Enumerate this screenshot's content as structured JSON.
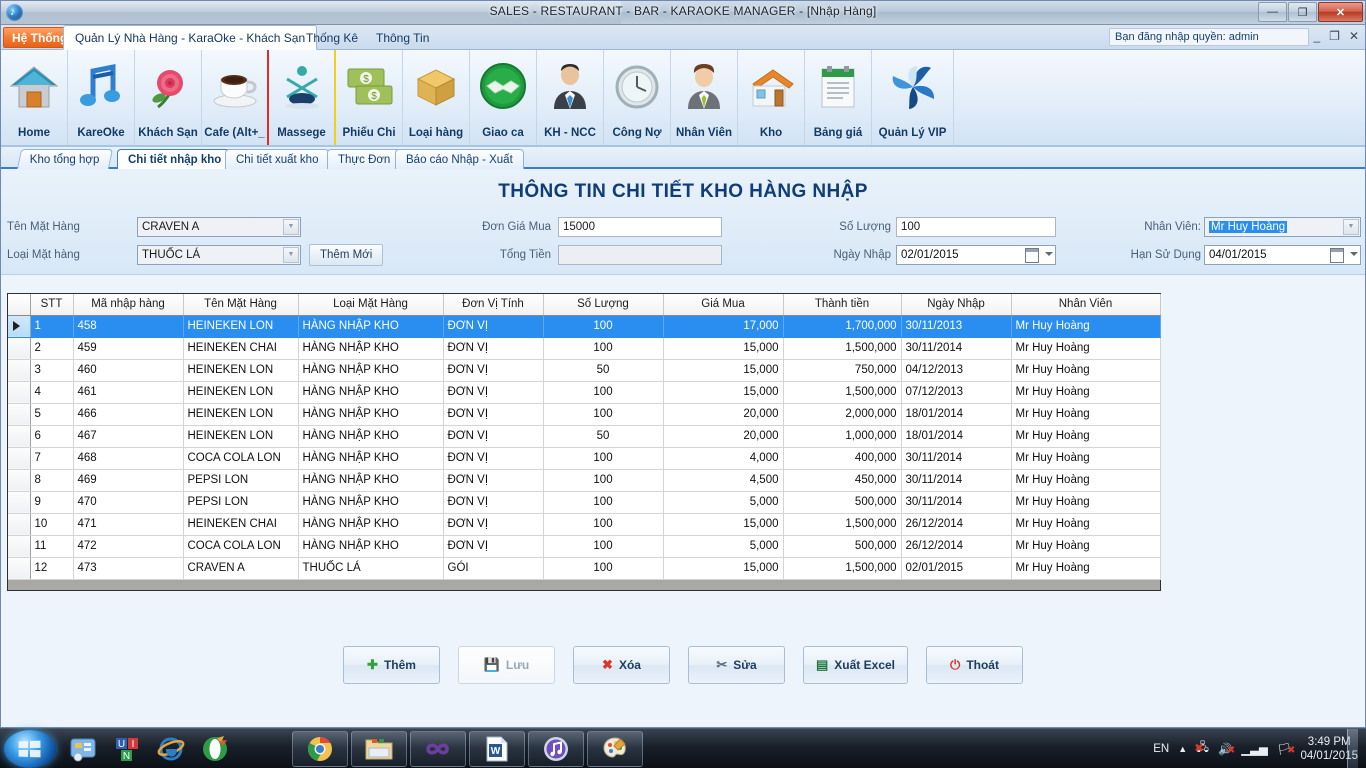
{
  "window": {
    "title": "SALES - RESTAURANT - BAR - KARAOKE MANAGER - [Nhập Hàng]",
    "icon": "music-note-icon",
    "minimize_label": "—",
    "maximize_label": "❐",
    "close_label": "✕"
  },
  "menu": {
    "system_button": "Hệ Thống",
    "tabs": [
      {
        "label": "Quản Lý Nhà Hàng - KaraOke - Khách Sạn",
        "active": true
      },
      {
        "label": "Thống Kê",
        "active": false
      },
      {
        "label": "Thông Tin",
        "active": false
      }
    ],
    "user_info": "Bạn đăng nhập quyền: admin",
    "mdi_minimize": "_",
    "mdi_restore": "❐",
    "mdi_close": "✕"
  },
  "ribbon": {
    "items": [
      {
        "label": "Home",
        "icon": "home-icon"
      },
      {
        "label": "KareOke",
        "icon": "music-notes-icon"
      },
      {
        "label": "Khách Sạn",
        "icon": "rose-icon"
      },
      {
        "label": "Cafe (Alt+_",
        "icon": "coffee-cup-icon"
      },
      {
        "label": "Massege",
        "icon": "massage-person-icon"
      },
      {
        "label": "Phiếu Chi",
        "icon": "money-bills-icon"
      },
      {
        "label": "Loại hàng",
        "icon": "wooden-box-icon"
      },
      {
        "label": "Giao ca",
        "icon": "handshake-icon"
      },
      {
        "label": "KH - NCC",
        "icon": "businessman-icon"
      },
      {
        "label": "Công Nợ",
        "icon": "clock-icon"
      },
      {
        "label": "Nhân Viên",
        "icon": "employee-icon"
      },
      {
        "label": "Kho",
        "icon": "warehouse-icon"
      },
      {
        "label": "Bảng giá",
        "icon": "pricelist-clipboard-icon"
      },
      {
        "label": "Quản Lý VIP",
        "icon": "vip-fan-icon"
      }
    ]
  },
  "page_tabs": [
    {
      "label": "Kho tổng hợp",
      "active": false
    },
    {
      "label": "Chi tiết nhập kho",
      "active": true
    },
    {
      "label": "Chi tiết xuất kho",
      "active": false
    },
    {
      "label": "Thực Đơn",
      "active": false
    },
    {
      "label": "Báo cáo Nhập - Xuất",
      "active": false
    }
  ],
  "form": {
    "title": "THÔNG TIN CHI TIẾT KHO HÀNG NHẬP",
    "ten_mat_hang_label": "Tên Mặt Hàng",
    "ten_mat_hang_value": "CRAVEN A",
    "loai_mat_hang_label": "Loại Mặt hàng",
    "loai_mat_hang_value": "THUỐC LÁ",
    "them_moi_label": "Thêm Mới",
    "don_gia_mua_label": "Đơn Giá Mua",
    "don_gia_mua_value": "15000",
    "tong_tien_label": "Tổng Tiền",
    "tong_tien_value": "",
    "so_luong_label": "Số Lượng",
    "so_luong_value": "100",
    "ngay_nhap_label": "Ngày Nhập",
    "ngay_nhap_value": "02/01/2015",
    "nhan_vien_label": "Nhân Viên:",
    "nhan_vien_value": "Mr Huy Hoàng",
    "han_su_dung_label": "Hạn Sử Dụng",
    "han_su_dung_value": "04/01/2015"
  },
  "grid": {
    "columns": [
      "STT",
      "Mã nhập hàng",
      "Tên Mặt Hàng",
      "Loại Mặt Hàng",
      "Đơn Vị Tính",
      "Số Lượng",
      "Giá Mua",
      "Thành tiền",
      "Ngày Nhập",
      "Nhân Viên"
    ],
    "rows": [
      {
        "stt": "1",
        "ma": "458",
        "ten": "HEINEKEN LON",
        "loai": "HÀNG NHẬP KHO",
        "dvt": "ĐƠN VỊ",
        "sl": "100",
        "gia": "17,000",
        "tt": "1,700,000",
        "ngay": "30/11/2013",
        "nv": "Mr Huy Hoàng",
        "selected": true
      },
      {
        "stt": "2",
        "ma": "459",
        "ten": "HEINEKEN CHAI",
        "loai": "HÀNG NHẬP KHO",
        "dvt": "ĐƠN VỊ",
        "sl": "100",
        "gia": "15,000",
        "tt": "1,500,000",
        "ngay": "30/11/2014",
        "nv": "Mr Huy Hoàng",
        "selected": false
      },
      {
        "stt": "3",
        "ma": "460",
        "ten": "HEINEKEN LON",
        "loai": "HÀNG NHẬP KHO",
        "dvt": "ĐƠN VỊ",
        "sl": "50",
        "gia": "15,000",
        "tt": "750,000",
        "ngay": "04/12/2013",
        "nv": "Mr Huy Hoàng",
        "selected": false
      },
      {
        "stt": "4",
        "ma": "461",
        "ten": "HEINEKEN LON",
        "loai": "HÀNG NHẬP KHO",
        "dvt": "ĐƠN VỊ",
        "sl": "100",
        "gia": "15,000",
        "tt": "1,500,000",
        "ngay": "07/12/2013",
        "nv": "Mr Huy Hoàng",
        "selected": false
      },
      {
        "stt": "5",
        "ma": "466",
        "ten": "HEINEKEN LON",
        "loai": "HÀNG NHẬP KHO",
        "dvt": "ĐƠN VỊ",
        "sl": "100",
        "gia": "20,000",
        "tt": "2,000,000",
        "ngay": "18/01/2014",
        "nv": "Mr Huy Hoàng",
        "selected": false
      },
      {
        "stt": "6",
        "ma": "467",
        "ten": "HEINEKEN LON",
        "loai": "HÀNG NHẬP KHO",
        "dvt": "ĐƠN VỊ",
        "sl": "50",
        "gia": "20,000",
        "tt": "1,000,000",
        "ngay": "18/01/2014",
        "nv": "Mr Huy Hoàng",
        "selected": false
      },
      {
        "stt": "7",
        "ma": "468",
        "ten": "COCA COLA LON",
        "loai": "HÀNG NHẬP KHO",
        "dvt": "ĐƠN VỊ",
        "sl": "100",
        "gia": "4,000",
        "tt": "400,000",
        "ngay": "30/11/2014",
        "nv": "Mr Huy Hoàng",
        "selected": false
      },
      {
        "stt": "8",
        "ma": "469",
        "ten": "PEPSI LON",
        "loai": "HÀNG NHẬP KHO",
        "dvt": "ĐƠN VỊ",
        "sl": "100",
        "gia": "4,500",
        "tt": "450,000",
        "ngay": "30/11/2014",
        "nv": "Mr Huy Hoàng",
        "selected": false
      },
      {
        "stt": "9",
        "ma": "470",
        "ten": "PEPSI LON",
        "loai": "HÀNG NHẬP KHO",
        "dvt": "ĐƠN VỊ",
        "sl": "100",
        "gia": "5,000",
        "tt": "500,000",
        "ngay": "30/11/2014",
        "nv": "Mr Huy Hoàng",
        "selected": false
      },
      {
        "stt": "10",
        "ma": "471",
        "ten": "HEINEKEN CHAI",
        "loai": "HÀNG NHẬP KHO",
        "dvt": "ĐƠN VỊ",
        "sl": "100",
        "gia": "15,000",
        "tt": "1,500,000",
        "ngay": "26/12/2014",
        "nv": "Mr Huy Hoàng",
        "selected": false
      },
      {
        "stt": "11",
        "ma": "472",
        "ten": "COCA COLA LON",
        "loai": "HÀNG NHẬP KHO",
        "dvt": "ĐƠN VỊ",
        "sl": "100",
        "gia": "5,000",
        "tt": "500,000",
        "ngay": "26/12/2014",
        "nv": "Mr Huy Hoàng",
        "selected": false
      },
      {
        "stt": "12",
        "ma": "473",
        "ten": "CRAVEN A",
        "loai": "THUỐC LÁ",
        "dvt": "GÓI",
        "sl": "100",
        "gia": "15,000",
        "tt": "1,500,000",
        "ngay": "02/01/2015",
        "nv": "Mr Huy Hoàng",
        "selected": false
      }
    ]
  },
  "footer_buttons": [
    {
      "label": "Thêm",
      "icon": "plus-icon",
      "disabled": false
    },
    {
      "label": "Lưu",
      "icon": "save-disk-icon",
      "disabled": true
    },
    {
      "label": "Xóa",
      "icon": "delete-x-icon",
      "disabled": false
    },
    {
      "label": "Sửa",
      "icon": "edit-tools-icon",
      "disabled": false
    },
    {
      "label": "Xuất Excel",
      "icon": "excel-icon",
      "disabled": false
    },
    {
      "label": "Thoát",
      "icon": "power-icon",
      "disabled": false
    }
  ],
  "taskbar": {
    "start_icon": "windows-start-orb",
    "quick_launch": [
      {
        "icon": "media-player-icon"
      },
      {
        "icon": "unikey-icon"
      },
      {
        "icon": "internet-explorer-icon"
      },
      {
        "icon": "opera-icon"
      }
    ],
    "task_buttons": [
      {
        "icon": "chrome-icon"
      },
      {
        "icon": "folder-explorer-icon"
      },
      {
        "icon": "visual-studio-icon"
      },
      {
        "icon": "word-icon"
      },
      {
        "icon": "itunes-icon"
      },
      {
        "icon": "paint-icon"
      }
    ],
    "language": "EN",
    "tray_icons": [
      "show-hidden-icon",
      "network-error-icon",
      "volume-muted-icon",
      "signal-icon",
      "action-center-icon"
    ],
    "time": "3:49 PM",
    "date": "04/01/2015"
  },
  "colors": {
    "accent_blue": "#2a8ef0",
    "title_blue": "#0f3d79",
    "orange": "#f47a2e",
    "tab_underline": "#3b7ec4"
  }
}
